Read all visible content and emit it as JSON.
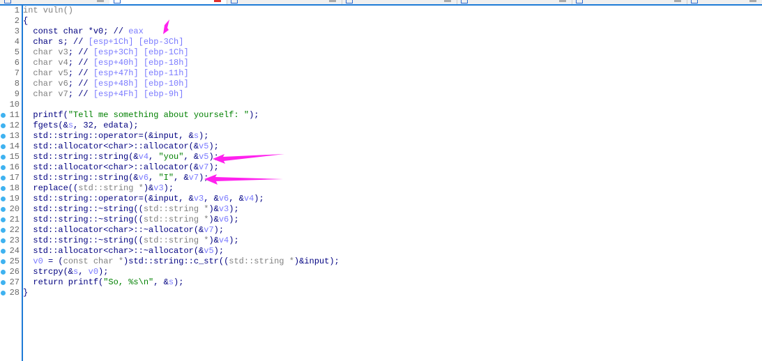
{
  "tabs": [
    {
      "active": false
    },
    {
      "active": true
    },
    {
      "active": false
    },
    {
      "active": false
    },
    {
      "active": false
    },
    {
      "active": false
    },
    {
      "active": false
    }
  ],
  "lines": [
    {
      "n": "1",
      "bp": false,
      "seg": [
        [
          "int vuln()",
          "g"
        ]
      ]
    },
    {
      "n": "2",
      "bp": false,
      "seg": [
        [
          "{",
          "k"
        ]
      ]
    },
    {
      "n": "3",
      "bp": false,
      "seg": [
        [
          "  const char *v0; // ",
          "k"
        ],
        [
          "eax",
          "v"
        ]
      ]
    },
    {
      "n": "4",
      "bp": false,
      "seg": [
        [
          "  char s; // ",
          "k"
        ],
        [
          "[esp+1Ch] [ebp-3Ch]",
          "v"
        ]
      ]
    },
    {
      "n": "5",
      "bp": false,
      "seg": [
        [
          "  char v3",
          "g"
        ],
        [
          "; // ",
          "k"
        ],
        [
          "[esp+3Ch] [ebp-1Ch]",
          "v"
        ]
      ]
    },
    {
      "n": "6",
      "bp": false,
      "seg": [
        [
          "  char v4",
          "g"
        ],
        [
          "; // ",
          "k"
        ],
        [
          "[esp+40h] [ebp-18h]",
          "v"
        ]
      ]
    },
    {
      "n": "7",
      "bp": false,
      "seg": [
        [
          "  char v5",
          "g"
        ],
        [
          "; // ",
          "k"
        ],
        [
          "[esp+47h] [ebp-11h]",
          "v"
        ]
      ]
    },
    {
      "n": "8",
      "bp": false,
      "seg": [
        [
          "  char v6",
          "g"
        ],
        [
          "; // ",
          "k"
        ],
        [
          "[esp+48h] [ebp-10h]",
          "v"
        ]
      ]
    },
    {
      "n": "9",
      "bp": false,
      "seg": [
        [
          "  char v7",
          "g"
        ],
        [
          "; // ",
          "k"
        ],
        [
          "[esp+4Fh] [ebp-9h]",
          "v"
        ]
      ]
    },
    {
      "n": "10",
      "bp": false,
      "seg": []
    },
    {
      "n": "11",
      "bp": true,
      "seg": [
        [
          "  printf(",
          "k"
        ],
        [
          "\"Tell me something about yourself: \"",
          "s"
        ],
        [
          ");",
          "k"
        ]
      ]
    },
    {
      "n": "12",
      "bp": true,
      "seg": [
        [
          "  fgets(&",
          "k"
        ],
        [
          "s",
          "v"
        ],
        [
          ", 32, edata);",
          "k"
        ]
      ]
    },
    {
      "n": "13",
      "bp": true,
      "seg": [
        [
          "  std::string::operator=(&input, &",
          "k"
        ],
        [
          "s",
          "v"
        ],
        [
          ");",
          "k"
        ]
      ]
    },
    {
      "n": "14",
      "bp": true,
      "seg": [
        [
          "  std::allocator<char>::allocator(&",
          "k"
        ],
        [
          "v5",
          "v"
        ],
        [
          ");",
          "k"
        ]
      ]
    },
    {
      "n": "15",
      "bp": true,
      "seg": [
        [
          "  std::string::string(&",
          "k"
        ],
        [
          "v4",
          "v"
        ],
        [
          ", ",
          "k"
        ],
        [
          "\"you\"",
          "s"
        ],
        [
          ", &",
          "k"
        ],
        [
          "v5",
          "v"
        ],
        [
          ");",
          "k"
        ]
      ]
    },
    {
      "n": "16",
      "bp": true,
      "seg": [
        [
          "  std::allocator<char>::allocator(&",
          "k"
        ],
        [
          "v7",
          "v"
        ],
        [
          ");",
          "k"
        ]
      ]
    },
    {
      "n": "17",
      "bp": true,
      "seg": [
        [
          "  std::string::string(&",
          "k"
        ],
        [
          "v6",
          "v"
        ],
        [
          ", ",
          "k"
        ],
        [
          "\"I\"",
          "s"
        ],
        [
          ", &",
          "k"
        ],
        [
          "v7",
          "v"
        ],
        [
          ");",
          "k"
        ]
      ]
    },
    {
      "n": "18",
      "bp": true,
      "seg": [
        [
          "  replace((",
          "k"
        ],
        [
          "std::string *",
          "g"
        ],
        [
          ")&",
          "k"
        ],
        [
          "v3",
          "v"
        ],
        [
          ");",
          "k"
        ]
      ]
    },
    {
      "n": "19",
      "bp": true,
      "seg": [
        [
          "  std::string::operator=(&input, &",
          "k"
        ],
        [
          "v3",
          "v"
        ],
        [
          ", &",
          "k"
        ],
        [
          "v6",
          "v"
        ],
        [
          ", &",
          "k"
        ],
        [
          "v4",
          "v"
        ],
        [
          ");",
          "k"
        ]
      ]
    },
    {
      "n": "20",
      "bp": true,
      "seg": [
        [
          "  std::string::~string((",
          "k"
        ],
        [
          "std::string *",
          "g"
        ],
        [
          ")&",
          "k"
        ],
        [
          "v3",
          "v"
        ],
        [
          ");",
          "k"
        ]
      ]
    },
    {
      "n": "21",
      "bp": true,
      "seg": [
        [
          "  std::string::~string((",
          "k"
        ],
        [
          "std::string *",
          "g"
        ],
        [
          ")&",
          "k"
        ],
        [
          "v6",
          "v"
        ],
        [
          ");",
          "k"
        ]
      ]
    },
    {
      "n": "22",
      "bp": true,
      "seg": [
        [
          "  std::allocator<char>::~allocator(&",
          "k"
        ],
        [
          "v7",
          "v"
        ],
        [
          ");",
          "k"
        ]
      ]
    },
    {
      "n": "23",
      "bp": true,
      "seg": [
        [
          "  std::string::~string((",
          "k"
        ],
        [
          "std::string *",
          "g"
        ],
        [
          ")&",
          "k"
        ],
        [
          "v4",
          "v"
        ],
        [
          ");",
          "k"
        ]
      ]
    },
    {
      "n": "24",
      "bp": true,
      "seg": [
        [
          "  std::allocator<char>::~allocator(&",
          "k"
        ],
        [
          "v5",
          "v"
        ],
        [
          ");",
          "k"
        ]
      ]
    },
    {
      "n": "25",
      "bp": true,
      "seg": [
        [
          "  ",
          "k"
        ],
        [
          "v0",
          "v"
        ],
        [
          " = (",
          "k"
        ],
        [
          "const char *",
          "g"
        ],
        [
          ")std::string::c_str((",
          "k"
        ],
        [
          "std::string *",
          "g"
        ],
        [
          ")&input);",
          "k"
        ]
      ]
    },
    {
      "n": "26",
      "bp": true,
      "seg": [
        [
          "  strcpy(&",
          "k"
        ],
        [
          "s",
          "v"
        ],
        [
          ", ",
          "k"
        ],
        [
          "v0",
          "v"
        ],
        [
          ");",
          "k"
        ]
      ]
    },
    {
      "n": "27",
      "bp": true,
      "seg": [
        [
          "  return printf(",
          "k"
        ],
        [
          "\"So, %s\\n\"",
          "s"
        ],
        [
          ", &",
          "k"
        ],
        [
          "s",
          "v"
        ],
        [
          ");",
          "k"
        ]
      ]
    },
    {
      "n": "28",
      "bp": true,
      "seg": [
        [
          "}",
          "k"
        ]
      ]
    }
  ],
  "colors": {
    "accent": "#1e7bd6",
    "arrow": "#ff22ee"
  }
}
